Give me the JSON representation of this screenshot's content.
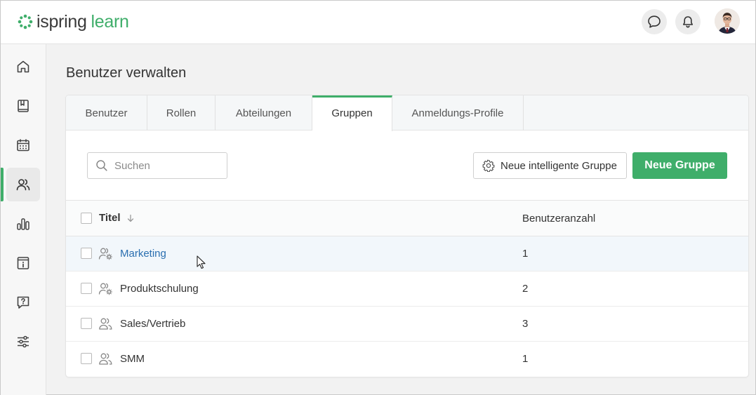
{
  "app": {
    "logo_brand": "ispring",
    "logo_product": "learn"
  },
  "header": {
    "icons": [
      "chat-icon",
      "bell-icon"
    ],
    "avatar": "user-avatar"
  },
  "sidebar": {
    "items": [
      {
        "icon": "home-icon"
      },
      {
        "icon": "book-icon"
      },
      {
        "icon": "calendar-icon"
      },
      {
        "icon": "users-icon",
        "active": true
      },
      {
        "icon": "bar-chart-icon"
      },
      {
        "icon": "info-window-icon"
      },
      {
        "icon": "question-bubble-icon"
      },
      {
        "icon": "sliders-icon"
      }
    ]
  },
  "page": {
    "title": "Benutzer verwalten"
  },
  "tabs": [
    {
      "label": "Benutzer"
    },
    {
      "label": "Rollen"
    },
    {
      "label": "Abteilungen"
    },
    {
      "label": "Gruppen",
      "active": true
    },
    {
      "label": "Anmeldungs-Profile"
    }
  ],
  "toolbar": {
    "search_placeholder": "Suchen",
    "smart_group_label": "Neue intelligente Gruppe",
    "new_group_label": "Neue Gruppe"
  },
  "table": {
    "columns": {
      "title": "Titel",
      "count": "Benutzeranzahl"
    },
    "rows": [
      {
        "title": "Marketing",
        "count": "1",
        "type": "smart",
        "link": true
      },
      {
        "title": "Produktschulung",
        "count": "2",
        "type": "smart"
      },
      {
        "title": "Sales/Vertrieb",
        "count": "3",
        "type": "regular"
      },
      {
        "title": "SMM",
        "count": "1",
        "type": "regular"
      }
    ]
  },
  "colors": {
    "accent": "#3fae6a",
    "link": "#2a6fb0"
  }
}
